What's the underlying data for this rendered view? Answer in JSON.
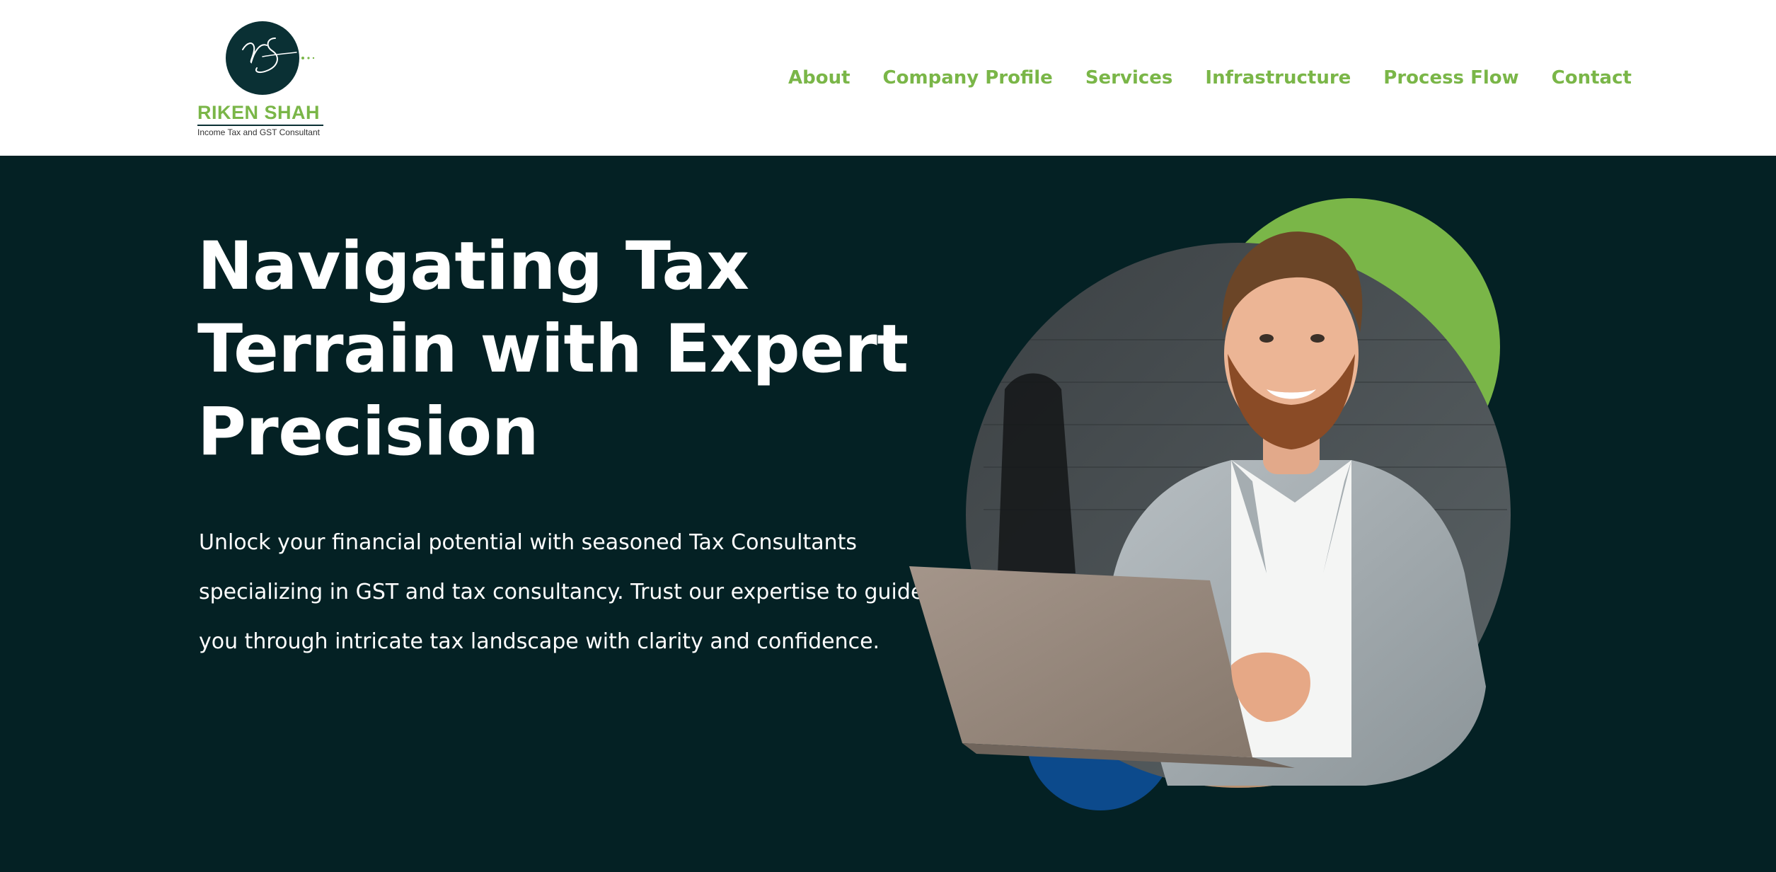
{
  "brand": {
    "name": "RIKEN SHAH",
    "tagline": "Income Tax and GST Consultant",
    "monogram": "rs",
    "colors": {
      "green": "#7ab648",
      "dark": "#042124",
      "blue": "#0c4a8c"
    }
  },
  "nav": {
    "items": [
      {
        "label": "About"
      },
      {
        "label": "Company Profile"
      },
      {
        "label": "Services"
      },
      {
        "label": "Infrastructure"
      },
      {
        "label": "Process Flow"
      },
      {
        "label": "Contact"
      }
    ]
  },
  "hero": {
    "title_lines": [
      "Navigating Tax",
      "Terrain with Expert",
      "Precision"
    ],
    "description_lines": [
      "Unlock your financial potential with seasoned Tax Consultants",
      "specializing in GST and tax consultancy. Trust our expertise to guide",
      "you through intricate tax landscape with clarity and confidence."
    ],
    "image_subject": "smiling-consultant-with-laptop"
  }
}
